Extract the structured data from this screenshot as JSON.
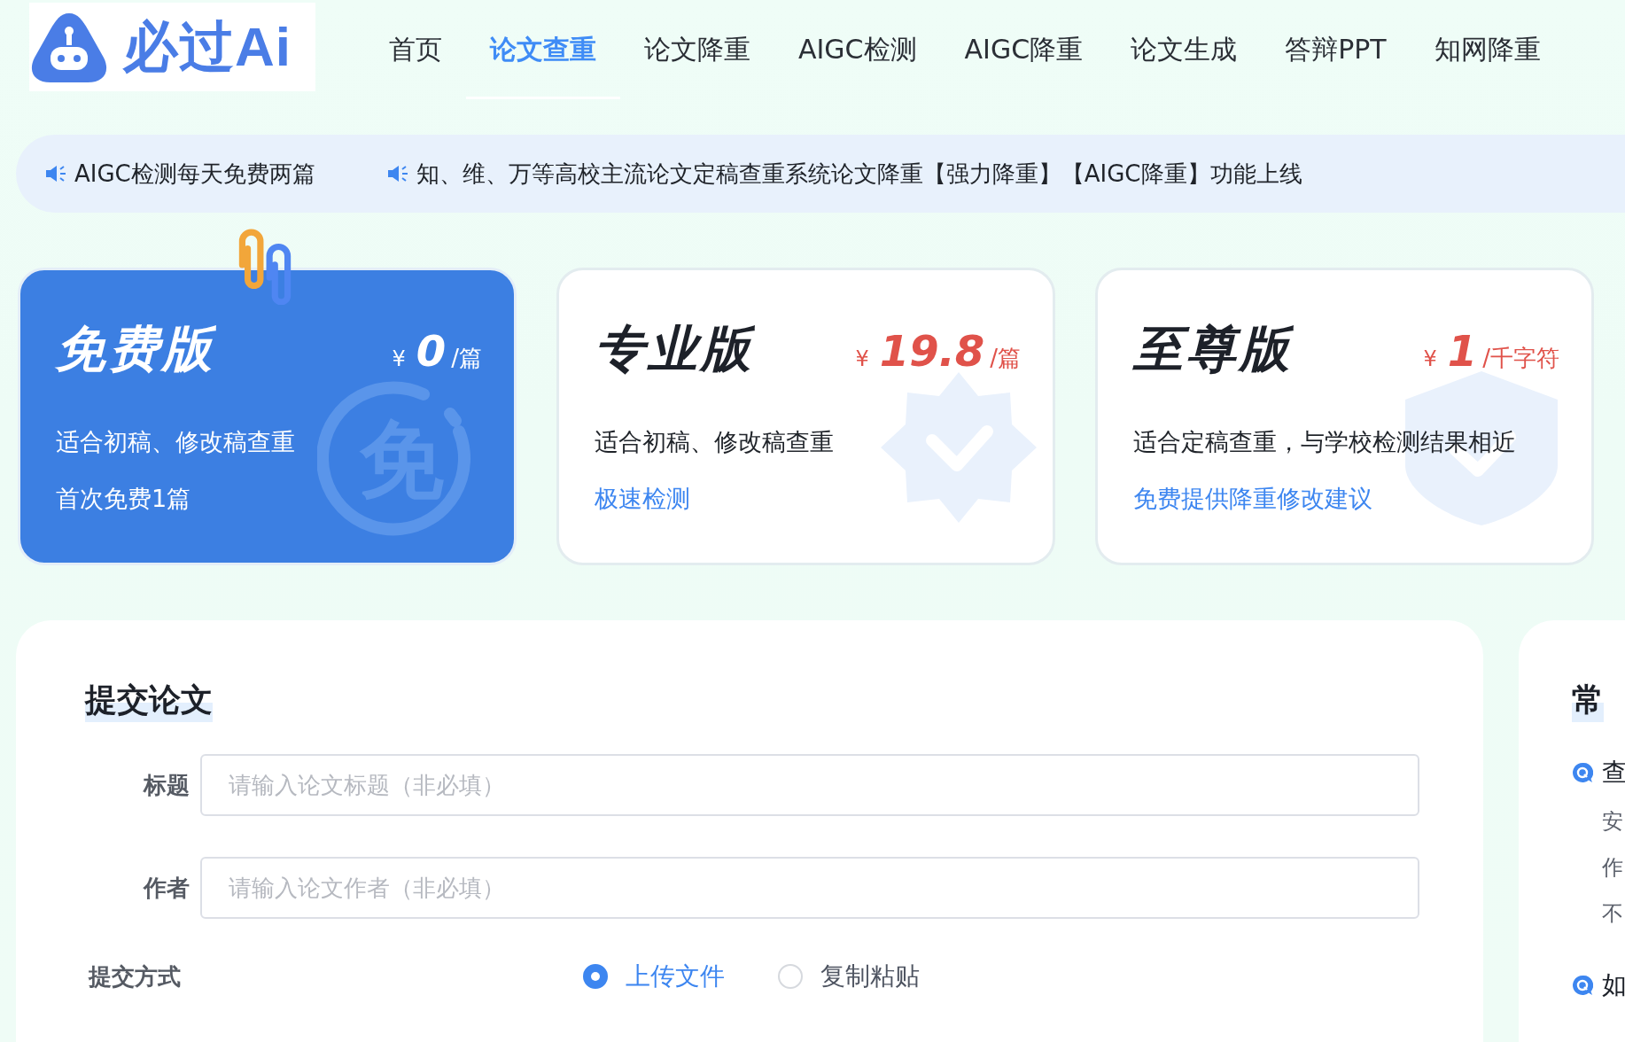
{
  "logo": {
    "text": "必过Ai"
  },
  "nav": [
    {
      "label": "首页",
      "selected": false
    },
    {
      "label": "论文查重",
      "selected": true
    },
    {
      "label": "论文降重",
      "selected": false
    },
    {
      "label": "AIGC检测",
      "selected": false
    },
    {
      "label": "AIGC降重",
      "selected": false
    },
    {
      "label": "论文生成",
      "selected": false
    },
    {
      "label": "答辩PPT",
      "selected": false
    },
    {
      "label": "知网降重",
      "selected": false
    }
  ],
  "notices": [
    "AIGC检测每天免费两篇",
    "知、维、万等高校主流论文定稿查重系统论文降重【强力降重】【AIGC降重】功能上线"
  ],
  "plans": [
    {
      "kind": "free",
      "selected": true,
      "name": "免费版",
      "currency": "¥",
      "price": "0",
      "unit": "/篇",
      "watermark": "免",
      "features": [
        {
          "text": "适合初稿、修改稿查重",
          "highlight": false
        },
        {
          "text": "首次免费1篇",
          "highlight": false
        }
      ]
    },
    {
      "kind": "pro",
      "selected": false,
      "name": "专业版",
      "currency": "¥",
      "price": "19.8",
      "unit": "/篇",
      "features": [
        {
          "text": "适合初稿、修改稿查重",
          "highlight": false
        },
        {
          "text": "极速检测",
          "highlight": true
        }
      ]
    },
    {
      "kind": "premium",
      "selected": false,
      "name": "至尊版",
      "currency": "¥",
      "price": "1",
      "unit": "/千字符",
      "features": [
        {
          "text": "适合定稿查重，与学校检测结果相近",
          "highlight": false
        },
        {
          "text": "免费提供降重修改建议",
          "highlight": true
        }
      ]
    }
  ],
  "form": {
    "title": "提交论文",
    "fields": [
      {
        "label": "标题",
        "placeholder": "请输入论文标题（非必填）"
      },
      {
        "label": "作者",
        "placeholder": "请输入论文作者（非必填）"
      }
    ],
    "method": {
      "label": "提交方式",
      "options": [
        {
          "label": "上传文件",
          "selected": true
        },
        {
          "label": "复制粘贴",
          "selected": false
        }
      ]
    }
  },
  "faq": {
    "title": "常",
    "items": [
      {
        "question": "查",
        "answer_lines": [
          "安",
          "作",
          "不"
        ]
      },
      {
        "question": "如"
      }
    ]
  }
}
